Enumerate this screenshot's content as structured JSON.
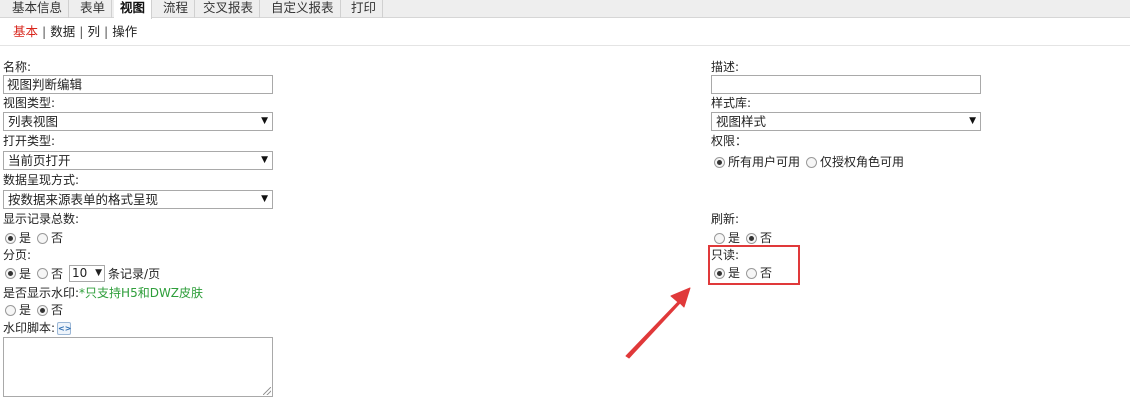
{
  "tabs": [
    "基本信息",
    "表单",
    "视图",
    "流程",
    "交叉报表",
    "自定义报表",
    "打印"
  ],
  "subnav": {
    "basic": "基本",
    "data": "数据",
    "columns": "列",
    "actions": "操作",
    "sep": "|"
  },
  "left": {
    "name_label": "名称:",
    "name_value": "视图判断编辑",
    "view_type_label": "视图类型:",
    "view_type_value": "列表视图",
    "open_type_label": "打开类型:",
    "open_type_value": "当前页打开",
    "data_present_label": "数据呈现方式:",
    "data_present_value": "按数据来源表单的格式呈现",
    "show_total_label": "显示记录总数:",
    "paging_label": "分页:",
    "page_size": "10",
    "page_size_unit": "条记录/页",
    "watermark_label": "是否显示水印:",
    "watermark_hint": "*只支持H5和DWZ皮肤",
    "watermark_script_label": "水印脚本:",
    "yes": "是",
    "no": "否"
  },
  "right": {
    "desc_label": "描述:",
    "style_lib_label": "样式库:",
    "style_lib_value": "视图样式",
    "permission_label": "权限：",
    "perm_all": "所有用户可用",
    "perm_role": "仅授权角色可用",
    "refresh_label": "刷新:",
    "readonly_label": "只读:",
    "yes": "是",
    "no": "否"
  },
  "colors": {
    "highlight": "#e0393a",
    "active_subnav": "#d9261c",
    "hint": "#2e9e3a"
  }
}
